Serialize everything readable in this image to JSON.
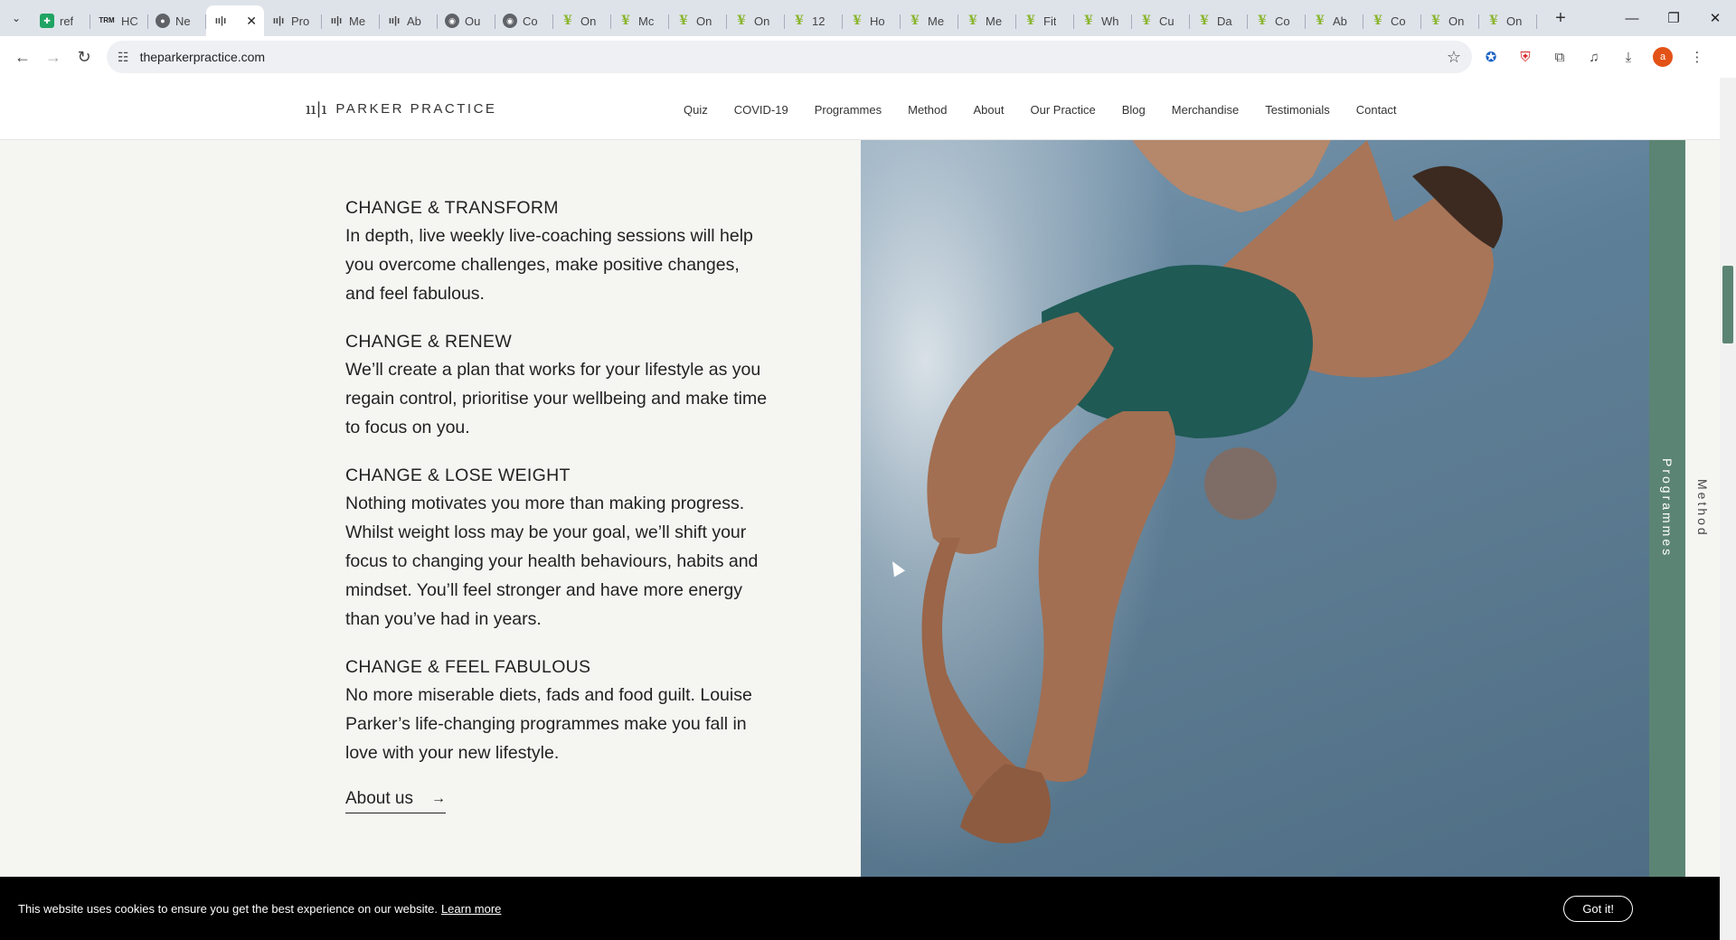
{
  "browser": {
    "tabs": [
      {
        "label": "ref",
        "icon": "sheets-icon"
      },
      {
        "label": "HC",
        "icon": "trm-icon"
      },
      {
        "label": "Ne",
        "icon": "chrome-icon"
      },
      {
        "label": "",
        "icon": "parker-icon",
        "active": true
      },
      {
        "label": "Pro",
        "icon": "parker-icon"
      },
      {
        "label": "Me",
        "icon": "parker-icon"
      },
      {
        "label": "Ab",
        "icon": "parker-icon"
      },
      {
        "label": "Ou",
        "icon": "msft-icon"
      },
      {
        "label": "Co",
        "icon": "msft-icon"
      },
      {
        "label": "On",
        "icon": "leaf-icon"
      },
      {
        "label": "Mc",
        "icon": "leaf-icon"
      },
      {
        "label": "On",
        "icon": "leaf-icon"
      },
      {
        "label": "On",
        "icon": "leaf-icon"
      },
      {
        "label": "12",
        "icon": "leaf-icon"
      },
      {
        "label": "Ho",
        "icon": "leaf-icon"
      },
      {
        "label": "Me",
        "icon": "leaf-icon"
      },
      {
        "label": "Me",
        "icon": "leaf-icon"
      },
      {
        "label": "Fit",
        "icon": "leaf-icon"
      },
      {
        "label": "Wh",
        "icon": "leaf-icon"
      },
      {
        "label": "Cu",
        "icon": "leaf-icon"
      },
      {
        "label": "Da",
        "icon": "leaf-icon"
      },
      {
        "label": "Co",
        "icon": "leaf-icon"
      },
      {
        "label": "Ab",
        "icon": "leaf-icon"
      },
      {
        "label": "Co",
        "icon": "leaf-icon"
      },
      {
        "label": "On",
        "icon": "leaf-icon"
      },
      {
        "label": "On",
        "icon": "leaf-icon"
      }
    ],
    "url": "theparkerpractice.com",
    "profile_initial": "a"
  },
  "site": {
    "logo_text": "PARKER PRACTICE",
    "nav": [
      "Quiz",
      "COVID-19",
      "Programmes",
      "Method",
      "About",
      "Our Practice",
      "Blog",
      "Merchandise",
      "Testimonials",
      "Contact"
    ],
    "sections": [
      {
        "title": "CHANGE & TRANSFORM",
        "body": "In depth, live weekly live-coaching sessions will help you overcome challenges, make positive changes, and feel fabulous."
      },
      {
        "title": "CHANGE & RENEW",
        "body": "We’ll create a plan that works for your lifestyle as you regain control, prioritise your wellbeing and make time to focus on you."
      },
      {
        "title": "CHANGE & LOSE WEIGHT",
        "body": "Nothing motivates you more than making progress. Whilst weight loss may be your goal, we’ll shift your focus to changing your health behaviours, habits and mindset. You’ll feel stronger and have more energy than you’ve had in years."
      },
      {
        "title": "CHANGE & FEEL FABULOUS",
        "body": "No more miserable diets, fads and food guilt. Louise Parker’s life-changing programmes make you fall in love with your new lifestyle."
      }
    ],
    "about_link": "About us",
    "side_tabs": {
      "programmes": "Programmes",
      "method": "Method"
    },
    "accent_color": "#5c8474"
  },
  "cookie": {
    "text": "This website uses cookies to ensure you get the best experience on our website.",
    "link": "Learn more",
    "button": "Got it!"
  }
}
